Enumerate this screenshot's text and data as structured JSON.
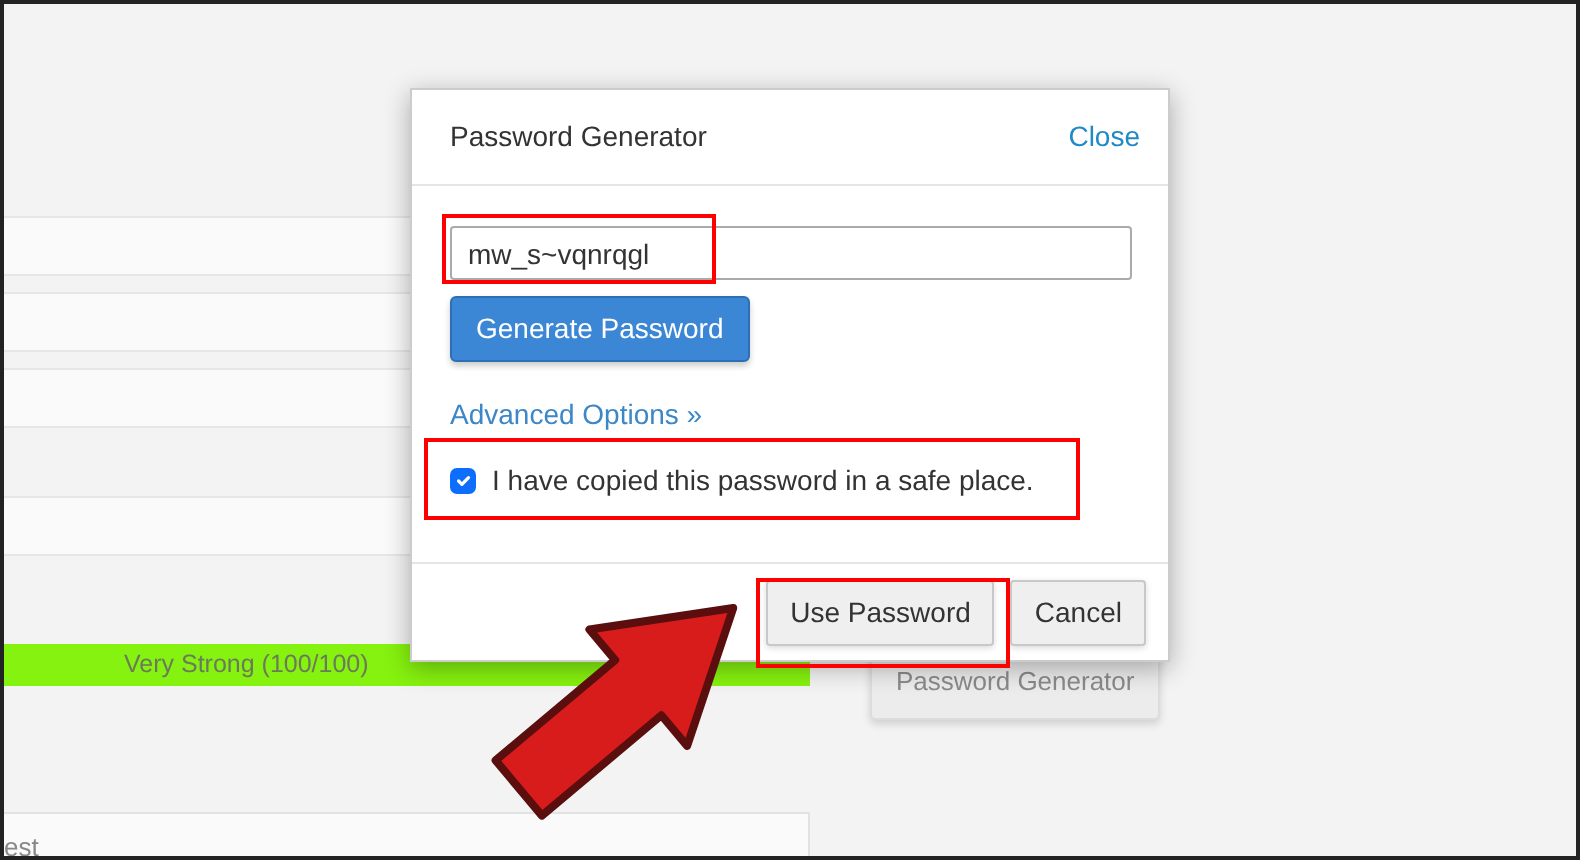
{
  "background": {
    "strength_meter": {
      "label": "Very Strong (100/100)",
      "level": 1
    },
    "generator_button": "Password Generator",
    "field_value": "est"
  },
  "dialog": {
    "title": "Password Generator",
    "close": "Close",
    "password": "mw_s~vqnrqgl",
    "generate_button": "Generate Password",
    "advanced_link": "Advanced Options »",
    "confirm": {
      "label": "I have copied this password in a safe place.",
      "checked": true
    },
    "buttons": [
      "Use Password",
      "Cancel"
    ]
  }
}
